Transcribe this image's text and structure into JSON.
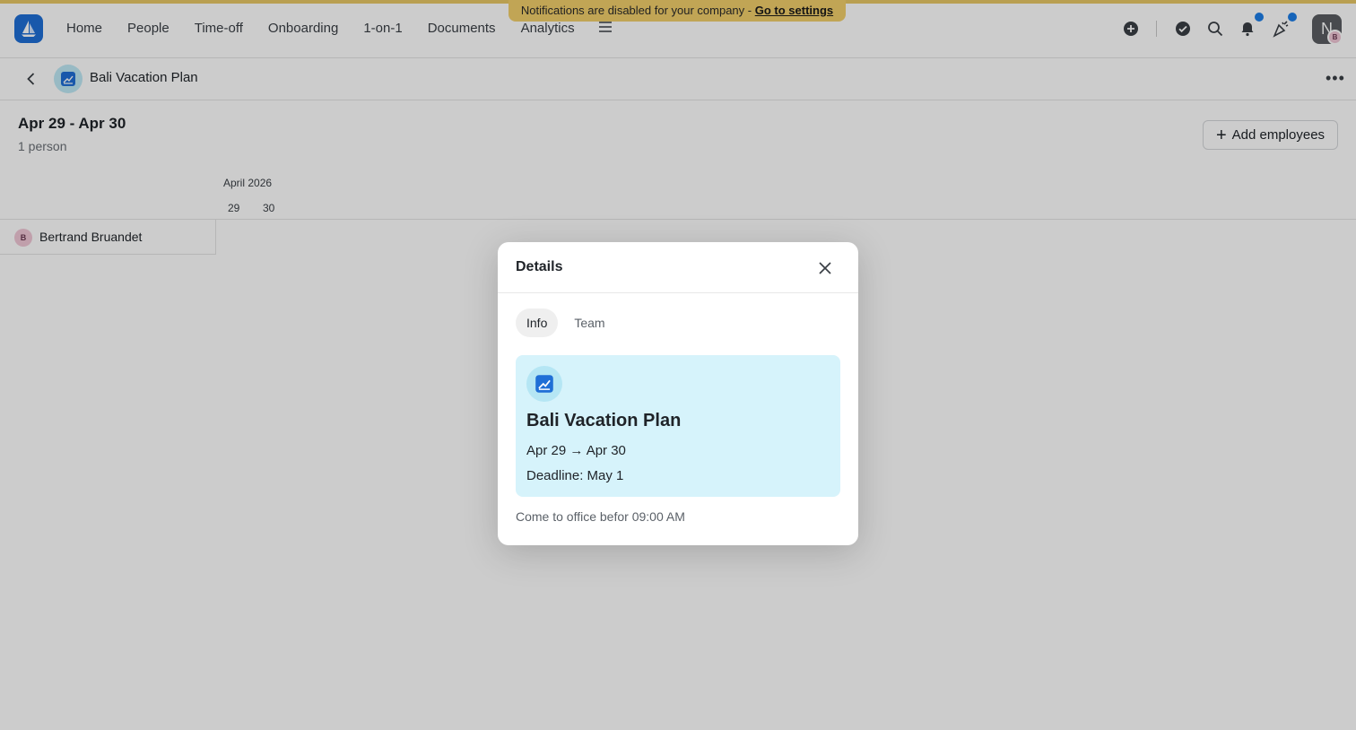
{
  "nav": {
    "items": [
      "Home",
      "People",
      "Time-off",
      "Onboarding",
      "1-on-1",
      "Documents",
      "Analytics"
    ],
    "more_icon": "hamburger-icon"
  },
  "banner": {
    "text": "Notifications are disabled for your company - ",
    "link": "Go to settings"
  },
  "user": {
    "initial": "N",
    "badge": "B"
  },
  "subheader": {
    "title": "Bali Vacation Plan"
  },
  "summary": {
    "range": "Apr 29 - Apr 30",
    "count": "1 person"
  },
  "add_button": {
    "label": "Add employees"
  },
  "calendar": {
    "month": "April 2026",
    "days": [
      "29",
      "30"
    ]
  },
  "employees": [
    {
      "initial": "B",
      "name": "Bertrand Bruandet"
    }
  ],
  "modal": {
    "title": "Details",
    "tabs": [
      "Info",
      "Team"
    ],
    "active_tab": "Info",
    "card": {
      "title": "Bali Vacation Plan",
      "dates": "Apr 29 → Apr 30",
      "deadline": "Deadline: May 1"
    },
    "note": "Come to office befor 09:00 AM"
  },
  "colors": {
    "brand": "#1f6fd6",
    "card_bg": "#d6f3fb",
    "banner_bg": "#f2cf6b",
    "notification_dot": "#1c7ee8"
  }
}
